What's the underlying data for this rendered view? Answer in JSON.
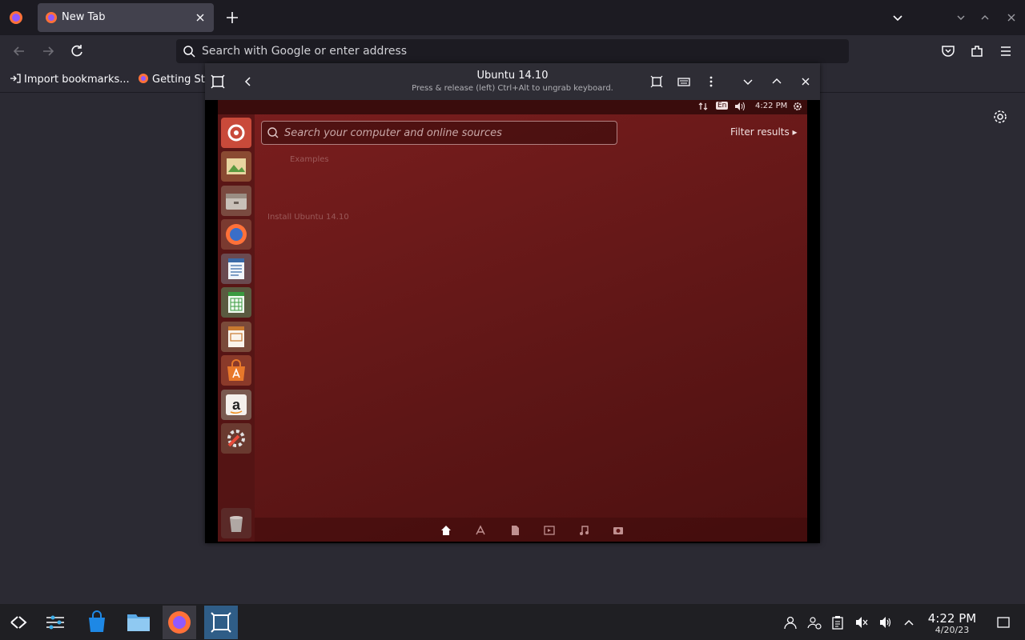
{
  "browser": {
    "tab": {
      "label": "New Tab"
    },
    "urlbar": {
      "placeholder": "Search with Google or enter address"
    },
    "bookmarks": [
      {
        "label": "Import bookmarks...",
        "icon": "import-icon"
      },
      {
        "label": "Getting St",
        "icon": "firefox-icon"
      }
    ]
  },
  "vm": {
    "title": "Ubuntu 14.10",
    "subtitle": "Press & release (left) Ctrl+Alt to ungrab keyboard."
  },
  "guest": {
    "panel": {
      "keyboard": "En",
      "time": "4:22 PM"
    },
    "search_placeholder": "Search your computer and online sources",
    "filter_label": "Filter results",
    "ghost_items": [
      "Examples",
      "Install Ubuntu 14.10"
    ],
    "launcher": [
      "dash-icon",
      "shotwell-icon",
      "files-icon",
      "firefox-icon",
      "writer-icon",
      "calc-icon",
      "impress-icon",
      "software-center-icon",
      "amazon-icon",
      "system-settings-icon",
      "trash-icon"
    ],
    "lenses": [
      "home-icon",
      "apps-icon",
      "files-icon",
      "video-icon",
      "music-icon",
      "photo-icon"
    ]
  },
  "taskbar": {
    "time": "4:22 PM",
    "date": "4/20/23"
  },
  "colors": {
    "browser_bg": "#2b2a33",
    "tabstrip_bg": "#1c1b22",
    "ubuntu_red": "#7b1e1e",
    "taskbar_bg": "#1f1f23",
    "taskbar_active": "#2f5d87"
  }
}
